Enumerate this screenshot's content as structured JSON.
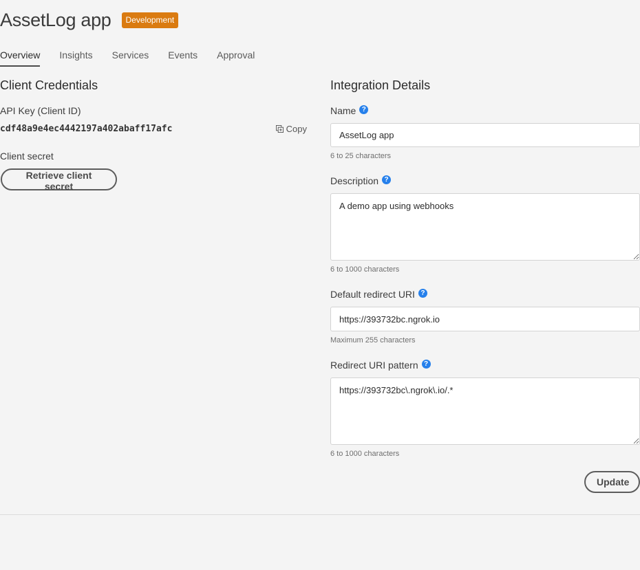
{
  "app": {
    "title": "AssetLog app",
    "environment": "Development"
  },
  "tabs": [
    {
      "label": "Overview",
      "active": true
    },
    {
      "label": "Insights"
    },
    {
      "label": "Services"
    },
    {
      "label": "Events"
    },
    {
      "label": "Approval"
    }
  ],
  "credentials": {
    "section_title": "Client Credentials",
    "api_key_label": "API Key (Client ID)",
    "api_key_value": "cdf48a9e4ec4442197a402abaff17afc",
    "copy_label": "Copy",
    "client_secret_label": "Client secret",
    "retrieve_button": "Retrieve client secret"
  },
  "integration": {
    "section_title": "Integration Details",
    "name": {
      "label": "Name",
      "value": "AssetLog app",
      "hint": "6 to 25 characters"
    },
    "description": {
      "label": "Description",
      "value": "A demo app using webhooks",
      "hint": "6 to 1000 characters"
    },
    "redirect_uri": {
      "label": "Default redirect URI",
      "value": "https://393732bc.ngrok.io",
      "hint": "Maximum 255 characters"
    },
    "redirect_pattern": {
      "label": "Redirect URI pattern",
      "value": "https://393732bc\\.ngrok\\.io/.*",
      "hint": "6 to 1000 characters"
    },
    "update_button": "Update"
  },
  "icons": {
    "help": "help-circle-icon",
    "copy": "copy-icon"
  },
  "colors": {
    "badge": "#da7b11",
    "help": "#2680eb"
  }
}
